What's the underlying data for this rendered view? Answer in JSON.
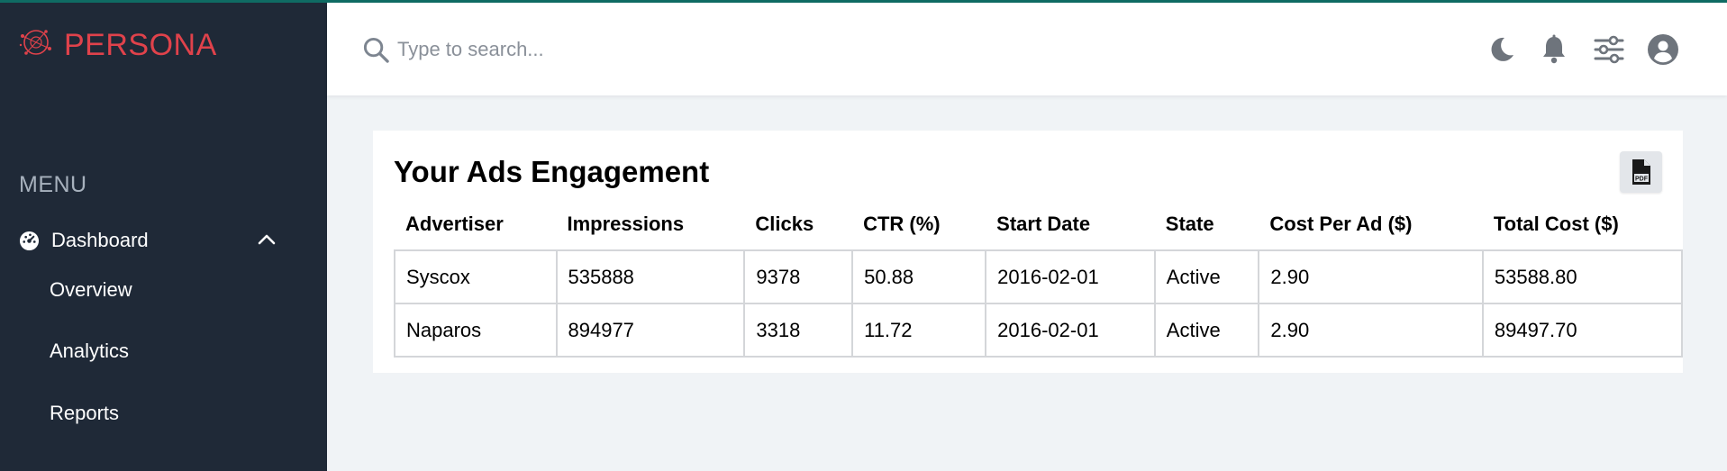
{
  "app": {
    "name": "PERSONA"
  },
  "sidebar": {
    "menu_label": "MENU",
    "dashboard": {
      "label": "Dashboard",
      "icon": "dashboard-icon"
    },
    "items": [
      {
        "label": "Overview"
      },
      {
        "label": "Analytics"
      },
      {
        "label": "Reports"
      }
    ]
  },
  "topbar": {
    "search": {
      "placeholder": "Type to search..."
    },
    "icons": [
      "moon-icon",
      "bell-icon",
      "sliders-icon",
      "user-icon"
    ]
  },
  "card": {
    "title": "Your Ads Engagement",
    "pdf_icon": "pdf-icon",
    "table": {
      "columns": [
        "Advertiser",
        "Impressions",
        "Clicks",
        "CTR (%)",
        "Start Date",
        "State",
        "Cost Per Ad ($)",
        "Total Cost ($)"
      ],
      "rows": [
        [
          "Syscox",
          "535888",
          "9378",
          "50.88",
          "2016-02-01",
          "Active",
          "2.90",
          "53588.80"
        ],
        [
          "Naparos",
          "894977",
          "3318",
          "11.72",
          "2016-02-01",
          "Active",
          "2.90",
          "89497.70"
        ]
      ]
    }
  },
  "colors": {
    "sidebar_bg": "#1f2937",
    "brand_red": "#e0424b",
    "accent_teal": "#0f6b63",
    "page_bg": "#f0f3f6"
  }
}
